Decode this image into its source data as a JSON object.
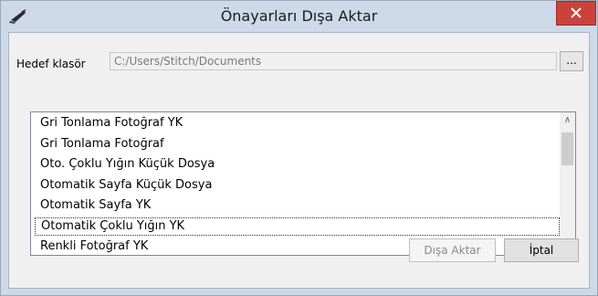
{
  "window": {
    "title": "Önayarları Dışa Aktar",
    "app_icon": "scanner-icon",
    "close_icon": "close-icon",
    "close_color": "#c9433a"
  },
  "form": {
    "folder_label": "Hedef klasör",
    "folder_value": "C:/Users/Stitch/Documents",
    "browse_label": "..."
  },
  "presets": {
    "items": [
      "Gri Tonlama Fotoğraf YK",
      "Gri Tonlama Fotoğraf",
      "Oto. Çoklu Yığın Küçük Dosya",
      "Otomatik Sayfa Küçük Dosya",
      "Otomatik Sayfa YK",
      "Otomatik Çoklu Yığın YK",
      "Renkli Fotoğraf YK"
    ],
    "selected_index": 5
  },
  "scrollbar": {
    "up_icon": "chevron-up-icon",
    "down_icon": "chevron-down-icon"
  },
  "buttons": {
    "export_label": "Dışa Aktar",
    "cancel_label": "İptal"
  }
}
